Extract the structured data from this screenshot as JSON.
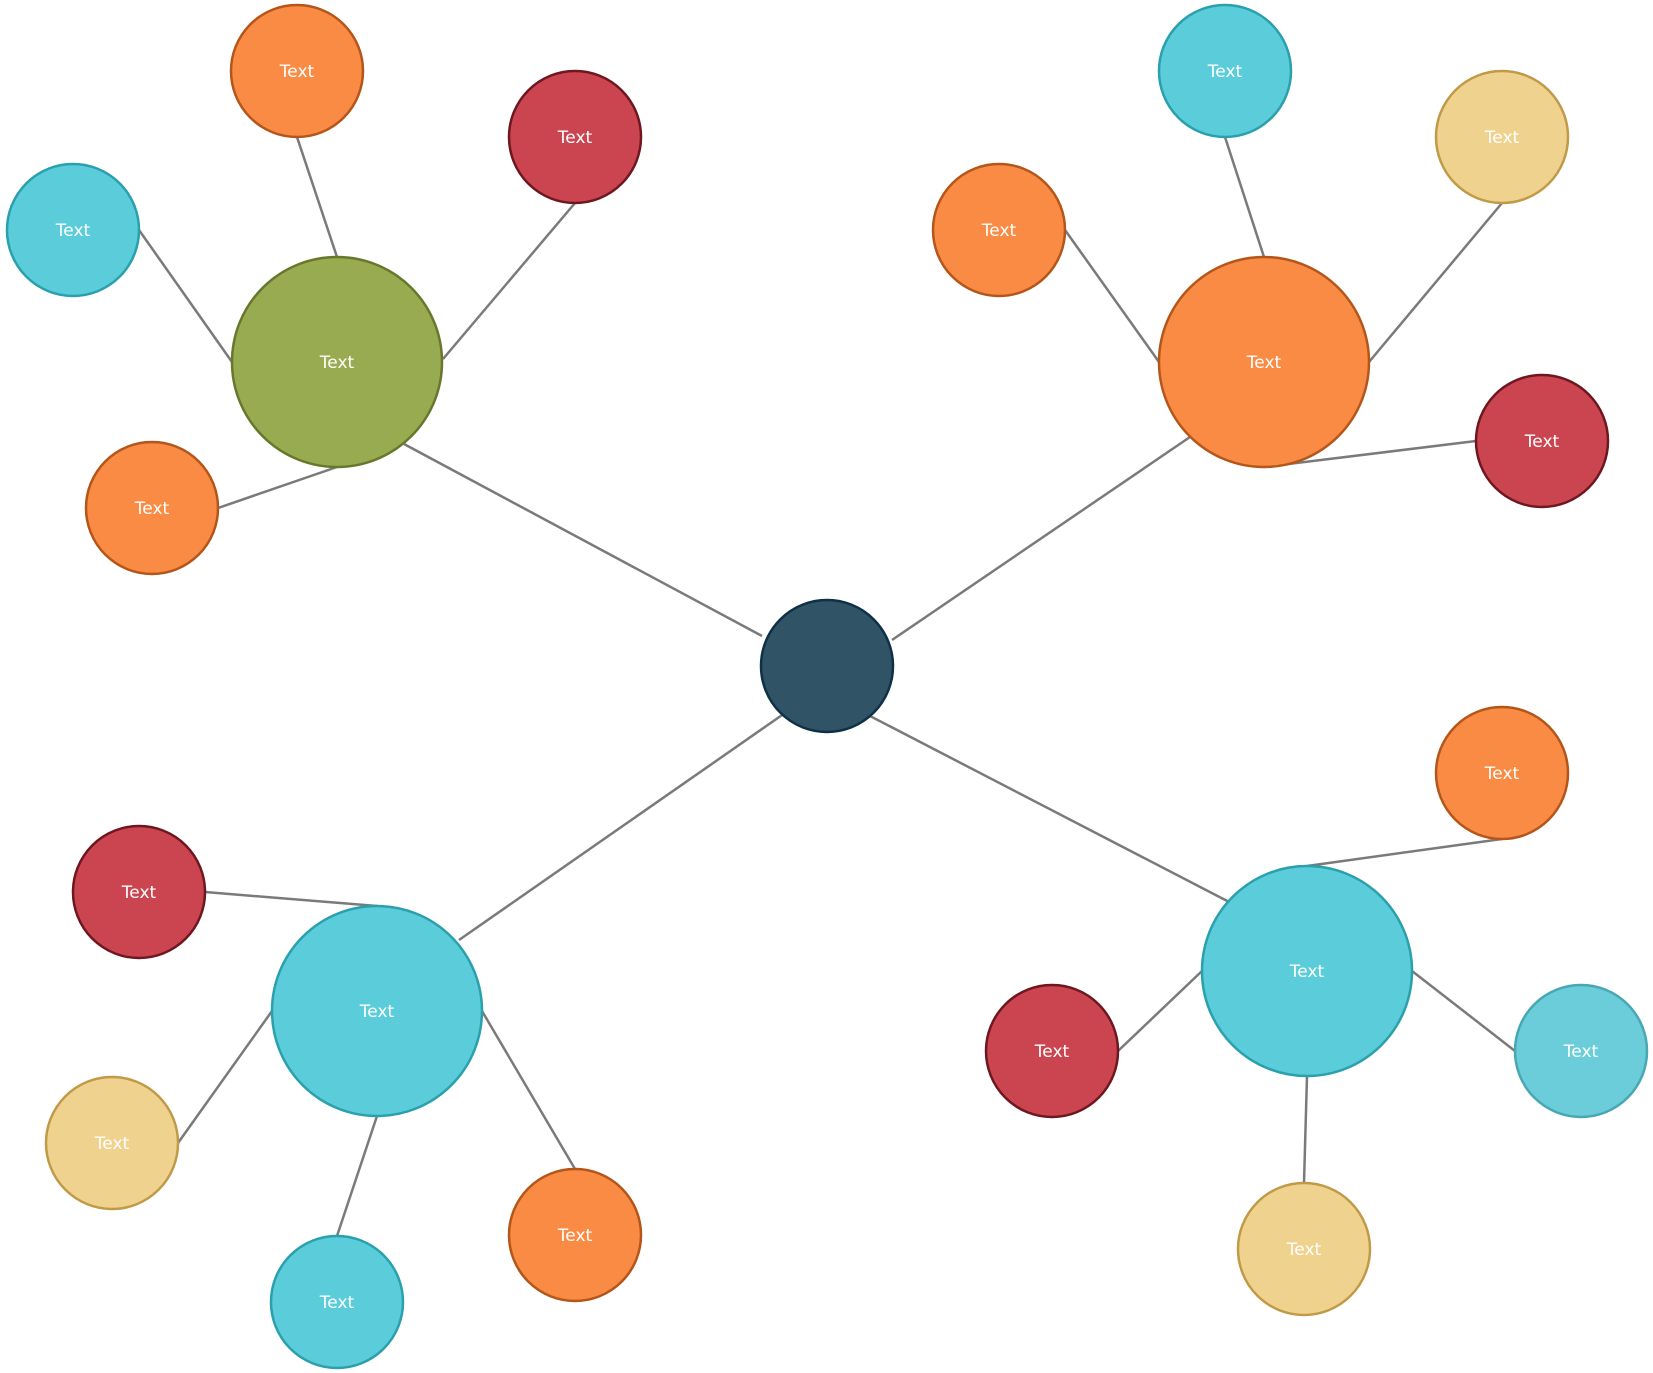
{
  "diagram": {
    "type": "bubble-map",
    "center": {
      "id": "center",
      "label": "",
      "color": "navy"
    },
    "nodes": [
      {
        "id": "hub-nw",
        "label": "Text",
        "color": "olive",
        "parent": "center"
      },
      {
        "id": "nw-1",
        "label": "Text",
        "color": "orange",
        "parent": "hub-nw"
      },
      {
        "id": "nw-2",
        "label": "Text",
        "color": "red",
        "parent": "hub-nw"
      },
      {
        "id": "nw-3",
        "label": "Text",
        "color": "cyan",
        "parent": "hub-nw"
      },
      {
        "id": "nw-4",
        "label": "Text",
        "color": "orange",
        "parent": "hub-nw"
      },
      {
        "id": "hub-ne",
        "label": "Text",
        "color": "orange",
        "parent": "center"
      },
      {
        "id": "ne-1",
        "label": "Text",
        "color": "cyan",
        "parent": "hub-ne"
      },
      {
        "id": "ne-2",
        "label": "Text",
        "color": "tan",
        "parent": "hub-ne"
      },
      {
        "id": "ne-3",
        "label": "Text",
        "color": "orange",
        "parent": "hub-ne"
      },
      {
        "id": "ne-4",
        "label": "Text",
        "color": "red",
        "parent": "hub-ne"
      },
      {
        "id": "hub-sw",
        "label": "Text",
        "color": "cyan",
        "parent": "center"
      },
      {
        "id": "sw-1",
        "label": "Text",
        "color": "red",
        "parent": "hub-sw"
      },
      {
        "id": "sw-2",
        "label": "Text",
        "color": "tan",
        "parent": "hub-sw"
      },
      {
        "id": "sw-3",
        "label": "Text",
        "color": "cyan",
        "parent": "hub-sw"
      },
      {
        "id": "sw-4",
        "label": "Text",
        "color": "orange",
        "parent": "hub-sw"
      },
      {
        "id": "hub-se",
        "label": "Text",
        "color": "cyan",
        "parent": "center"
      },
      {
        "id": "se-1",
        "label": "Text",
        "color": "orange",
        "parent": "hub-se"
      },
      {
        "id": "se-2",
        "label": "Text",
        "color": "red",
        "parent": "hub-se"
      },
      {
        "id": "se-3",
        "label": "Text",
        "color": "lightcyan",
        "parent": "hub-se"
      },
      {
        "id": "se-4",
        "label": "Text",
        "color": "tan",
        "parent": "hub-se"
      }
    ],
    "palette": {
      "navy": {
        "fill": "#315366",
        "stroke": "#0f3047"
      },
      "olive": {
        "fill": "#99ab51",
        "stroke": "#67772b"
      },
      "orange": {
        "fill": "#f98b44",
        "stroke": "#b4561a"
      },
      "red": {
        "fill": "#cb4550",
        "stroke": "#6e1720"
      },
      "cyan": {
        "fill": "#5bccd9",
        "stroke": "#2aa0ad"
      },
      "lightcyan": {
        "fill": "#6bcdd9",
        "stroke": "#47a7b3"
      },
      "tan": {
        "fill": "#f0d28f",
        "stroke": "#c09a48"
      }
    },
    "edge_color": "#7a7a7a",
    "label_color": "#ffffff"
  }
}
